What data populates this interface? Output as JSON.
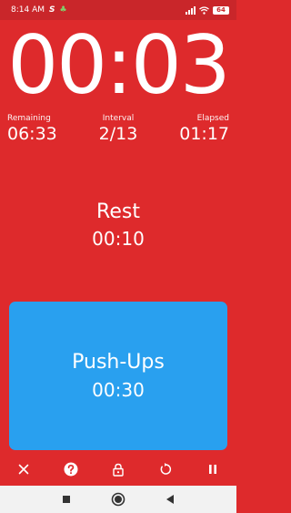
{
  "status_bar": {
    "time": "8:14 AM",
    "notification_icons": [
      "s-icon",
      "clover-icon"
    ],
    "battery": "64"
  },
  "timer": {
    "main": "00:03",
    "remaining_label": "Remaining",
    "remaining_value": "06:33",
    "interval_label": "Interval",
    "interval_value": "2/13",
    "elapsed_label": "Elapsed",
    "elapsed_value": "01:17"
  },
  "current": {
    "title": "Rest",
    "time": "00:10"
  },
  "next": {
    "title": "Push-Ups",
    "time": "00:30"
  },
  "toolbar": {
    "icons": [
      "close-icon",
      "help-icon",
      "lock-icon",
      "reset-icon",
      "pause-icon"
    ]
  },
  "colors": {
    "background": "#de2a2c",
    "status_bar": "#c9262a",
    "card": "#29a0ef",
    "text": "#ffffff",
    "navbar": "#f2f2f2"
  }
}
